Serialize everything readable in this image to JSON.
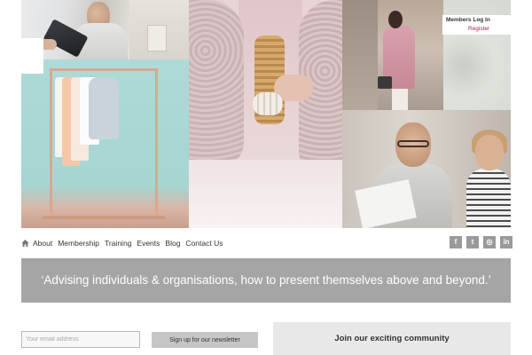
{
  "members": {
    "login_label": "Members Log In",
    "register_label": "Register"
  },
  "nav": {
    "home_icon": "home-icon",
    "items": [
      "About",
      "Membership",
      "Training",
      "Events",
      "Blog",
      "Contact Us"
    ]
  },
  "social": [
    {
      "name": "facebook-icon",
      "glyph": "f"
    },
    {
      "name": "twitter-icon",
      "glyph": "t"
    },
    {
      "name": "instagram-icon",
      "glyph": "◎"
    },
    {
      "name": "linkedin-icon",
      "glyph": "in"
    }
  ],
  "banner": {
    "text": "‘Advising individuals & organisations, how to present themselves above and beyond.’"
  },
  "newsletter": {
    "email_placeholder": "Your email address",
    "email_value": "",
    "signup_label": "Sign up for our newsletter"
  },
  "community": {
    "label": "Join our exciting community"
  },
  "colors": {
    "banner_bg": "#a5a5a5",
    "register_accent": "#b2264a",
    "social_bg": "#9a9a9a"
  }
}
